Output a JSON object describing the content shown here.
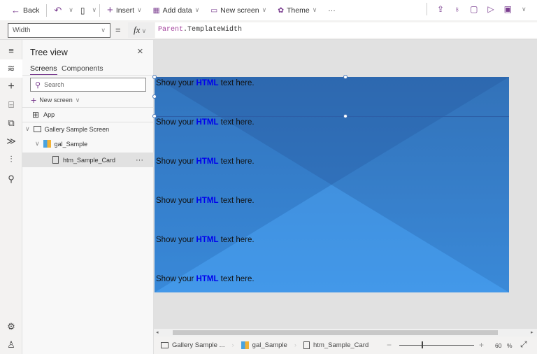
{
  "toolbar": {
    "back": "Back",
    "insert": "Insert",
    "add_data": "Add data",
    "new_screen": "New screen",
    "theme": "Theme",
    "more": "···"
  },
  "formula_bar": {
    "property": "Width",
    "equals": "=",
    "fx": "fx",
    "formula_obj": "Parent",
    "formula_rest": ".TemplateWidth"
  },
  "tree": {
    "title": "Tree view",
    "tabs": [
      "Screens",
      "Components"
    ],
    "search_placeholder": "Search",
    "new_screen": "New screen",
    "items": [
      {
        "label": "App"
      },
      {
        "label": "Gallery Sample Screen"
      },
      {
        "label": "gal_Sample"
      },
      {
        "label": "htm_Sample_Card"
      }
    ],
    "more": "···"
  },
  "canvas": {
    "rows": [
      {
        "pre": "Show your ",
        "bold": "HTML",
        "post": " text here."
      },
      {
        "pre": "Show your ",
        "bold": "HTML",
        "post": " text here."
      },
      {
        "pre": "Show your ",
        "bold": "HTML",
        "post": " text here."
      },
      {
        "pre": "Show your ",
        "bold": "HTML",
        "post": " text here."
      },
      {
        "pre": "Show your ",
        "bold": "HTML",
        "post": " text here."
      },
      {
        "pre": "Show your ",
        "bold": "HTML",
        "post": " text here."
      }
    ]
  },
  "status": {
    "crumbs": [
      "Gallery Sample ...",
      "gal_Sample",
      "htm_Sample_Card"
    ],
    "zoom_minus": "−",
    "zoom_plus": "+",
    "zoom": "60",
    "zoom_unit": "%",
    "zoom_fraction": 0.6
  }
}
